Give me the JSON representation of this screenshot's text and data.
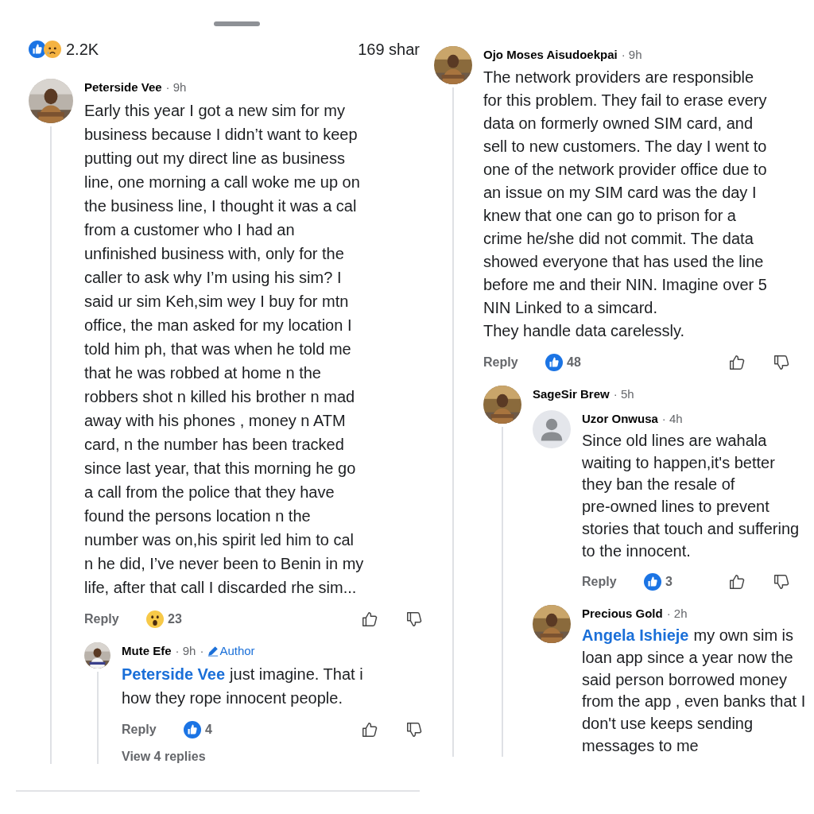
{
  "panels": [
    {
      "summary": {
        "count": "2.2K",
        "shares": "169 shar"
      },
      "comments": [
        {
          "name": "Peterside Vee",
          "time": "· 9h",
          "avatar": {
            "kind": "picture"
          },
          "lines": [
            "Early this year I got a new sim for my",
            "business because I didn’t want to keep",
            "putting out my direct line as business",
            "line, one morning a call woke me up on",
            "the business line, I thought it was a cal",
            "from a customer who I had an",
            "unfinished business with, only for the",
            "caller to ask why I’m using his sim? I",
            "said ur sim Keh,sim wey I buy for mtn",
            "office, the man asked for my location I",
            "told him ph, that was when he told me",
            "that he was robbed at home n the",
            "robbers shot n killed his brother n mad",
            "away with his phones , money n ATM",
            "card, n the number has been tracked",
            "since last year, that this morning he go",
            "a call from the police that they have",
            "found the persons location n the",
            "number was on,his spirit led him to cal",
            "n he did, I’ve never been to Benin in my",
            "life, after that call I discarded rhe sim..."
          ],
          "reply": "Reply",
          "reaction": {
            "kind": "wow",
            "count": "23"
          },
          "children": [
            {
              "name": "Mute Efe",
              "time": "· 9h",
              "badge": {
                "separator": "·",
                "label": "Author"
              },
              "avatar": {
                "kind": "picture"
              },
              "mention": "Peterside Vee",
              "lines": [
                "just imagine. That i",
                "how they rope innocent people."
              ],
              "reply": "Reply",
              "reaction": {
                "kind": "like",
                "count": "4"
              },
              "more_replies": "View 4 replies"
            }
          ]
        }
      ]
    },
    {
      "comments": [
        {
          "name": "Ojo Moses Aisudoekpai",
          "time": "· 9h",
          "avatar": {
            "kind": "picture"
          },
          "lines": [
            "The network providers are responsible",
            "for this problem. They fail to erase every",
            "data on formerly owned SIM card, and",
            "sell to new customers. The day I went to",
            "one of the network provider office due to",
            "an issue on my SIM card was the day I",
            "knew that one can go to prison for a",
            "crime he/she did not commit. The data",
            "showed everyone that has used the line",
            "before me and their NIN. Imagine over 5",
            "NIN Linked to a simcard.",
            "They handle data carelessly."
          ],
          "reply": "Reply",
          "reaction": {
            "kind": "like",
            "count": "48"
          },
          "children": [
            {
              "name": "SageSir Brew",
              "time": "· 5h",
              "avatar": {
                "kind": "picture"
              },
              "children": [
                {
                  "name": "Uzor Onwusa",
                  "time": "· 4h",
                  "avatar": {
                    "kind": "default"
                  },
                  "lines": [
                    "Since old lines are wahala",
                    "waiting to happen,it's better",
                    "they ban the resale of",
                    "pre-owned lines to prevent",
                    "stories that touch and suffering",
                    "to the innocent."
                  ],
                  "reply": "Reply",
                  "reaction": {
                    "kind": "like",
                    "count": "3"
                  }
                },
                {
                  "name": "Precious Gold",
                  "time": "· 2h",
                  "avatar": {
                    "kind": "picture"
                  },
                  "mention": "Angela Ishieje",
                  "lines": [
                    "my own sim is",
                    "loan app since a year now the",
                    "said person borrowed money",
                    "from the app , even banks that I",
                    "don't use keeps sending",
                    "messages to me"
                  ]
                }
              ]
            }
          ]
        }
      ]
    }
  ]
}
